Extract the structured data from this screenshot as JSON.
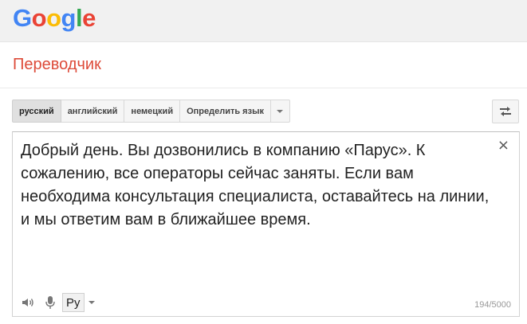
{
  "header": {
    "logo": [
      "G",
      "o",
      "o",
      "g",
      "l",
      "e"
    ],
    "logo_colors": [
      "#4285F4",
      "#EA4335",
      "#FBBC05",
      "#4285F4",
      "#34A853",
      "#EA4335"
    ]
  },
  "product": {
    "title": "Переводчик"
  },
  "source_languages": {
    "items": [
      {
        "label": "русский",
        "selected": true
      },
      {
        "label": "английский",
        "selected": false
      },
      {
        "label": "немецкий",
        "selected": false
      },
      {
        "label": "Определить язык",
        "selected": false
      }
    ]
  },
  "source": {
    "text": "Добрый день. Вы дозвонились в компанию «Парус». К сожалению, все операторы сейчас заняты. Если вам необходима консультация специалиста, оставайтесь на линии, и мы ответим вам в ближайшее время.",
    "clear_glyph": "×",
    "keyboard_label": "Ру",
    "char_count": "194/5000"
  },
  "icons": {
    "speaker": "speaker-icon",
    "mic": "microphone-icon",
    "swap": "swap-icon",
    "clear": "close-icon"
  }
}
